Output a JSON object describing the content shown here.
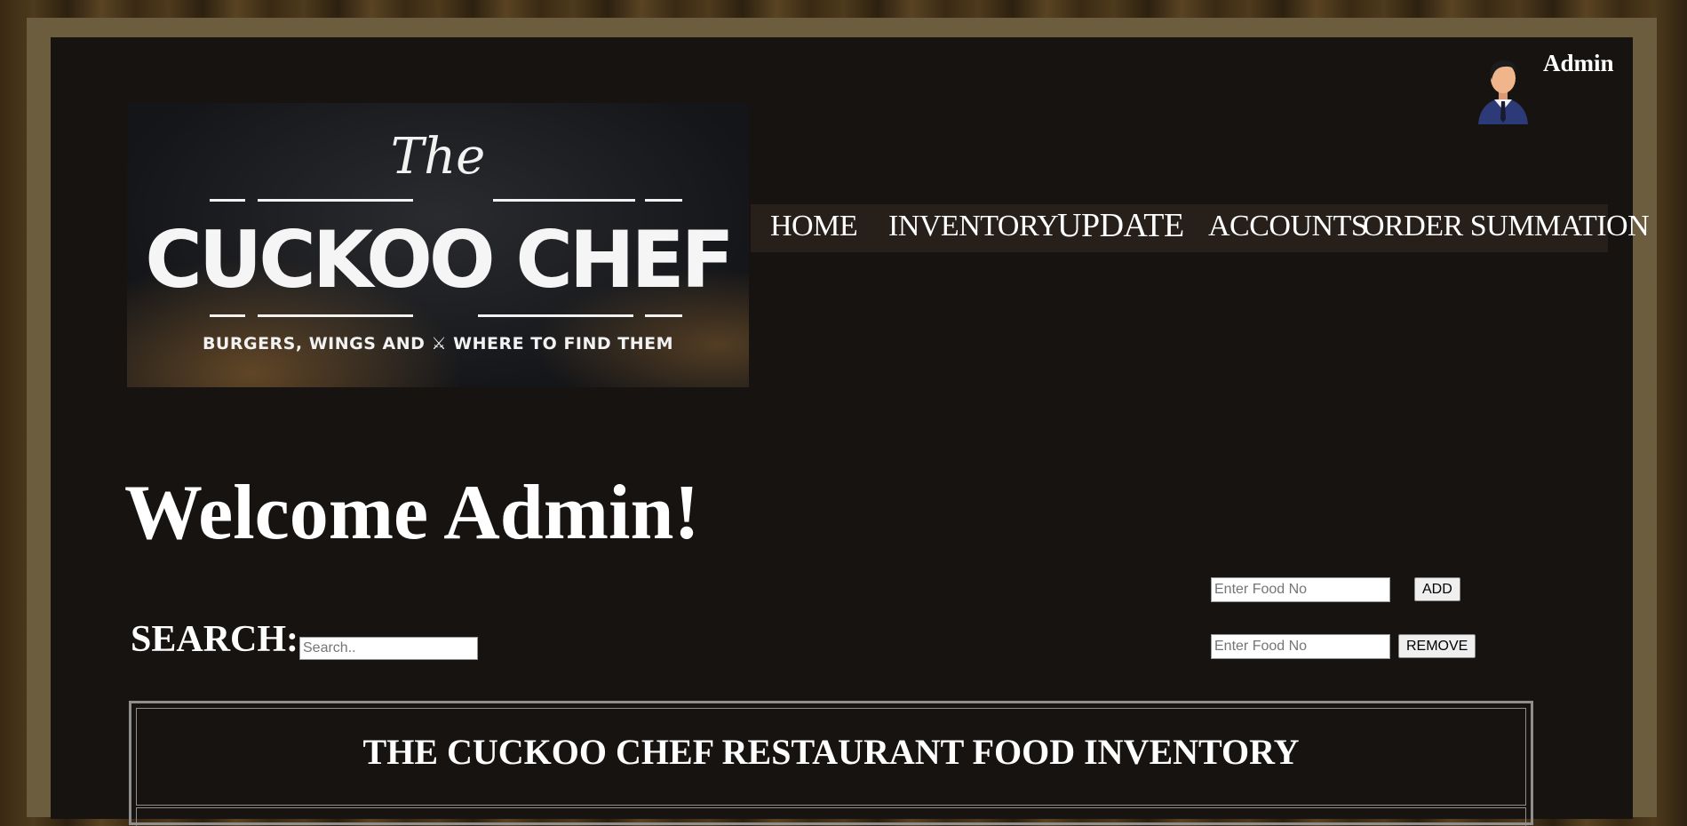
{
  "header": {
    "admin_name": "Admin",
    "avatar_icon": "admin-avatar-icon"
  },
  "logo": {
    "the": "The",
    "name": "CUCKOO CHEF",
    "tagline": "BURGERS, WINGS AND ⚔ WHERE TO FIND THEM"
  },
  "nav": {
    "items": [
      {
        "label": "HOME"
      },
      {
        "label": "INVENTORY"
      },
      {
        "label": "UPDATE"
      },
      {
        "label": "ACCOUNTS"
      },
      {
        "label": "ORDER SUMMATION"
      }
    ],
    "active": "UPDATE"
  },
  "main": {
    "welcome": "Welcome Admin!",
    "search_label": "SEARCH:",
    "search_placeholder": "Search..",
    "add_placeholder": "Enter Food No",
    "add_label": "ADD",
    "remove_placeholder": "Enter Food No",
    "remove_label": "REMOVE"
  },
  "table": {
    "title": "THE CUCKOO CHEF RESTAURANT FOOD INVENTORY"
  },
  "colors": {
    "panel_bg": "#171310",
    "frame": "#6d5d3f",
    "nav_bg": "#27201a",
    "text": "#ffffff"
  }
}
